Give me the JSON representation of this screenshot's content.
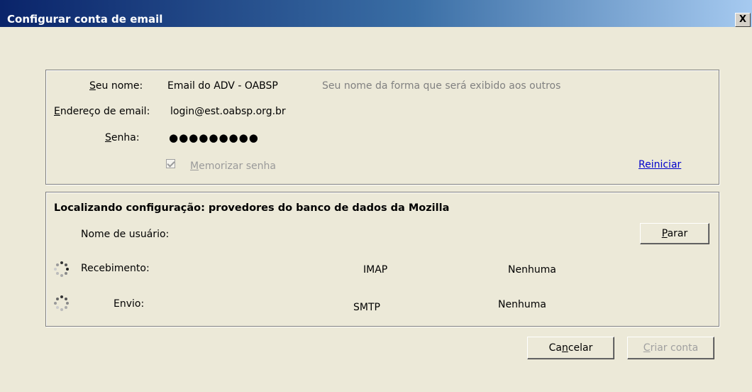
{
  "window": {
    "title": "Configurar conta de email",
    "close_label": "X"
  },
  "account": {
    "name_label_prefix": "S",
    "name_label_rest": "eu nome:",
    "name_value": "Email do ADV - OABSP",
    "name_hint": "Seu nome da forma que será exibido aos outros",
    "email_label_prefix": "E",
    "email_label_rest": "ndereço de email:",
    "email_value": "login@est.oabsp.org.br",
    "password_label_prefix": "S",
    "password_label_rest": "enha:",
    "password_value": "●●●●●●●●●",
    "remember_checked": true,
    "remember_label_prefix": "M",
    "remember_label_rest": "emorizar senha",
    "restart_link": "Reiniciar"
  },
  "config": {
    "heading": "Localizando configuração: provedores do banco de dados da Mozilla",
    "username_label": "Nome de usuário:",
    "stop_button_prefix": "P",
    "stop_button_rest": "arar",
    "incoming_label": "Recebimento:",
    "incoming_protocol": "IMAP",
    "incoming_security": "Nenhuma",
    "outgoing_label": "Envio:",
    "outgoing_protocol": "SMTP",
    "outgoing_security": "Nenhuma"
  },
  "footer": {
    "cancel_prefix": "Ca",
    "cancel_u": "n",
    "cancel_rest": "celar",
    "create_prefix": "C",
    "create_rest": "riar conta"
  },
  "colors": {
    "titlebar_start": "#0a246a",
    "titlebar_end": "#a6caf0",
    "dialog_bg": "#ece9d8",
    "link": "#0000cc"
  }
}
